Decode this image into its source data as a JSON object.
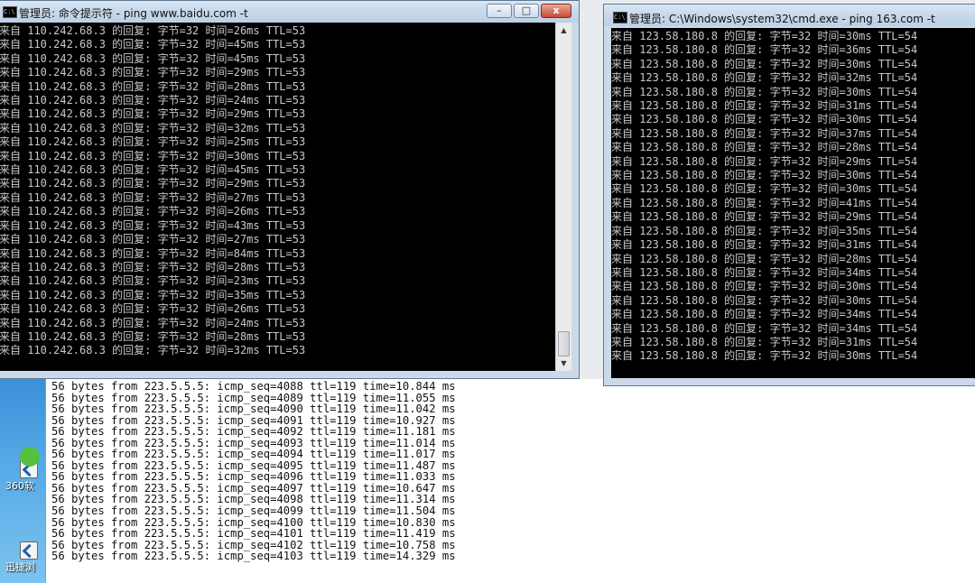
{
  "win_left": {
    "title": "管理员: 命令提示符 - ping  www.baidu.com -t",
    "lines": [
      "来自 110.242.68.3 的回复: 字节=32 时间=26ms TTL=53",
      "来自 110.242.68.3 的回复: 字节=32 时间=45ms TTL=53",
      "来自 110.242.68.3 的回复: 字节=32 时间=45ms TTL=53",
      "来自 110.242.68.3 的回复: 字节=32 时间=29ms TTL=53",
      "来自 110.242.68.3 的回复: 字节=32 时间=28ms TTL=53",
      "来自 110.242.68.3 的回复: 字节=32 时间=24ms TTL=53",
      "来自 110.242.68.3 的回复: 字节=32 时间=29ms TTL=53",
      "来自 110.242.68.3 的回复: 字节=32 时间=32ms TTL=53",
      "来自 110.242.68.3 的回复: 字节=32 时间=25ms TTL=53",
      "来自 110.242.68.3 的回复: 字节=32 时间=30ms TTL=53",
      "来自 110.242.68.3 的回复: 字节=32 时间=45ms TTL=53",
      "来自 110.242.68.3 的回复: 字节=32 时间=29ms TTL=53",
      "来自 110.242.68.3 的回复: 字节=32 时间=27ms TTL=53",
      "来自 110.242.68.3 的回复: 字节=32 时间=26ms TTL=53",
      "来自 110.242.68.3 的回复: 字节=32 时间=43ms TTL=53",
      "来自 110.242.68.3 的回复: 字节=32 时间=27ms TTL=53",
      "来自 110.242.68.3 的回复: 字节=32 时间=84ms TTL=53",
      "来自 110.242.68.3 的回复: 字节=32 时间=28ms TTL=53",
      "来自 110.242.68.3 的回复: 字节=32 时间=23ms TTL=53",
      "来自 110.242.68.3 的回复: 字节=32 时间=35ms TTL=53",
      "来自 110.242.68.3 的回复: 字节=32 时间=26ms TTL=53",
      "来自 110.242.68.3 的回复: 字节=32 时间=24ms TTL=53",
      "来自 110.242.68.3 的回复: 字节=32 时间=28ms TTL=53",
      "来自 110.242.68.3 的回复: 字节=32 时间=32ms TTL=53"
    ]
  },
  "win_right": {
    "title": "管理员: C:\\Windows\\system32\\cmd.exe - ping    163.com -t",
    "lines": [
      "来自 123.58.180.8 的回复: 字节=32 时间=30ms TTL=54",
      "来自 123.58.180.8 的回复: 字节=32 时间=36ms TTL=54",
      "来自 123.58.180.8 的回复: 字节=32 时间=30ms TTL=54",
      "来自 123.58.180.8 的回复: 字节=32 时间=32ms TTL=54",
      "来自 123.58.180.8 的回复: 字节=32 时间=30ms TTL=54",
      "来自 123.58.180.8 的回复: 字节=32 时间=31ms TTL=54",
      "来自 123.58.180.8 的回复: 字节=32 时间=30ms TTL=54",
      "来自 123.58.180.8 的回复: 字节=32 时间=37ms TTL=54",
      "来自 123.58.180.8 的回复: 字节=32 时间=28ms TTL=54",
      "来自 123.58.180.8 的回复: 字节=32 时间=29ms TTL=54",
      "来自 123.58.180.8 的回复: 字节=32 时间=30ms TTL=54",
      "来自 123.58.180.8 的回复: 字节=32 时间=30ms TTL=54",
      "来自 123.58.180.8 的回复: 字节=32 时间=41ms TTL=54",
      "来自 123.58.180.8 的回复: 字节=32 时间=29ms TTL=54",
      "来自 123.58.180.8 的回复: 字节=32 时间=35ms TTL=54",
      "来自 123.58.180.8 的回复: 字节=32 时间=31ms TTL=54",
      "来自 123.58.180.8 的回复: 字节=32 时间=28ms TTL=54",
      "来自 123.58.180.8 的回复: 字节=32 时间=34ms TTL=54",
      "来自 123.58.180.8 的回复: 字节=32 时间=30ms TTL=54",
      "来自 123.58.180.8 的回复: 字节=32 时间=30ms TTL=54",
      "来自 123.58.180.8 的回复: 字节=32 时间=34ms TTL=54",
      "来自 123.58.180.8 的回复: 字节=32 时间=34ms TTL=54",
      "来自 123.58.180.8 的回复: 字节=32 时间=31ms TTL=54",
      "来自 123.58.180.8 的回复: 字节=32 时间=30ms TTL=54"
    ]
  },
  "terminal": {
    "lines": [
      "56 bytes from 223.5.5.5: icmp_seq=4088 ttl=119 time=10.844 ms",
      "56 bytes from 223.5.5.5: icmp_seq=4089 ttl=119 time=11.055 ms",
      "56 bytes from 223.5.5.5: icmp_seq=4090 ttl=119 time=11.042 ms",
      "56 bytes from 223.5.5.5: icmp_seq=4091 ttl=119 time=10.927 ms",
      "56 bytes from 223.5.5.5: icmp_seq=4092 ttl=119 time=11.181 ms",
      "56 bytes from 223.5.5.5: icmp_seq=4093 ttl=119 time=11.014 ms",
      "56 bytes from 223.5.5.5: icmp_seq=4094 ttl=119 time=11.017 ms",
      "56 bytes from 223.5.5.5: icmp_seq=4095 ttl=119 time=11.487 ms",
      "56 bytes from 223.5.5.5: icmp_seq=4096 ttl=119 time=11.033 ms",
      "56 bytes from 223.5.5.5: icmp_seq=4097 ttl=119 time=10.647 ms",
      "56 bytes from 223.5.5.5: icmp_seq=4098 ttl=119 time=11.314 ms",
      "56 bytes from 223.5.5.5: icmp_seq=4099 ttl=119 time=11.504 ms",
      "56 bytes from 223.5.5.5: icmp_seq=4100 ttl=119 time=10.830 ms",
      "56 bytes from 223.5.5.5: icmp_seq=4101 ttl=119 time=11.419 ms",
      "56 bytes from 223.5.5.5: icmp_seq=4102 ttl=119 time=10.758 ms",
      "56 bytes from 223.5.5.5: icmp_seq=4103 ttl=119 time=14.329 ms"
    ]
  },
  "desktop": {
    "icon1_label": "360软",
    "icon2_label": "迅捷浏"
  },
  "buttons": {
    "minimize": "–",
    "maximize": "□",
    "close": "x"
  },
  "colors": {
    "console_bg": "#000000",
    "console_fg": "#c8c8c8",
    "titlebar": "#c7d8ea",
    "close_button": "#c84a32",
    "desktop": "#3b90d8"
  }
}
